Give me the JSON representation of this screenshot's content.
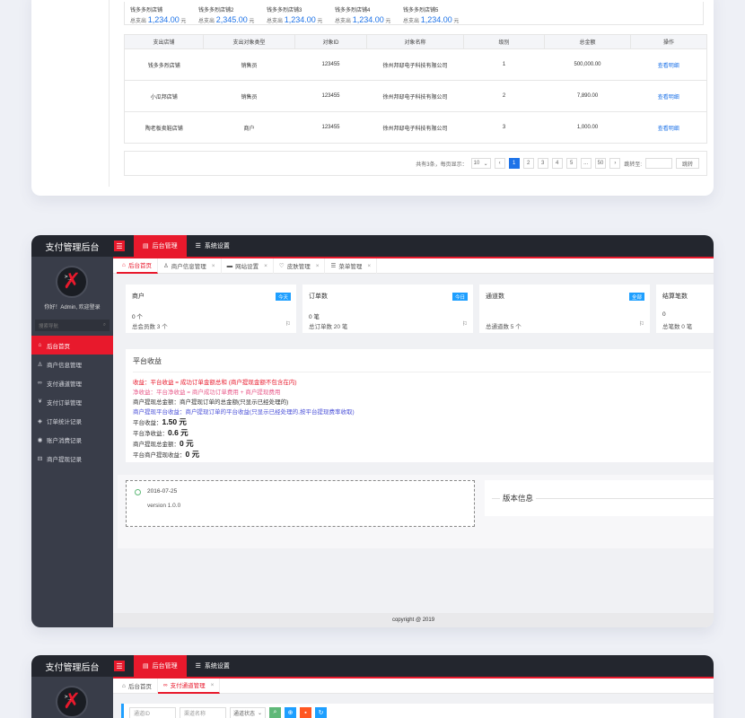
{
  "card1": {
    "stats": [
      {
        "name": "钱多多烈店铺",
        "label": "总支出",
        "amount": "1,234.00",
        "unit": "元"
      },
      {
        "name": "钱多多烈店铺2",
        "label": "总支出",
        "amount": "2,345.00",
        "unit": "元"
      },
      {
        "name": "钱多多烈店铺3",
        "label": "总支出",
        "amount": "1,234.00",
        "unit": "元"
      },
      {
        "name": "钱多多烈店铺4",
        "label": "总支出",
        "amount": "1,234.00",
        "unit": "元"
      },
      {
        "name": "钱多多烈店铺5",
        "label": "总支出",
        "amount": "1,234.00",
        "unit": "元"
      }
    ],
    "table": {
      "headers": [
        "支出店铺",
        "支出对象类型",
        "对象ID",
        "对象名称",
        "级别",
        "总金额",
        "操作"
      ],
      "rows": [
        [
          "钱多多烈店铺",
          "销售员",
          "123455",
          "徐州邦邸电子科技有限公司",
          "1",
          "500,000.00",
          "查看明细"
        ],
        [
          "小瓜邦店铺",
          "销售员",
          "123455",
          "徐州邦邸电子科技有限公司",
          "2",
          "7,890.00",
          "查看明细"
        ],
        [
          "陶老板卖鞋店铺",
          "商户",
          "123455",
          "徐州邦邸电子科技有限公司",
          "3",
          "1,000.00",
          "查看明细"
        ]
      ]
    },
    "pager": {
      "summary": "共有3条，每页显示：",
      "per_page": "10",
      "prev": "‹",
      "pages": [
        "1",
        "2",
        "3",
        "4",
        "5",
        "...",
        "50"
      ],
      "next": "›",
      "jump_label": "跳转至:",
      "go": "跳转"
    }
  },
  "win2": {
    "brand": "支付管理后台",
    "top_nav": [
      {
        "label": "后台管理",
        "icon": "document-icon"
      },
      {
        "label": "系统设置",
        "icon": "list-icon"
      }
    ],
    "welcome": "你好！Admin, 欢迎登录",
    "search_placeholder": "搜索导航",
    "side_menu": [
      {
        "label": "后台首页",
        "icon": "home-icon"
      },
      {
        "label": "商户信息管理",
        "icon": "user-icon"
      },
      {
        "label": "支付通道管理",
        "icon": "link-icon"
      },
      {
        "label": "支付订单管理",
        "icon": "yen-icon"
      },
      {
        "label": "订单统计记录",
        "icon": "shield-check-icon"
      },
      {
        "label": "账户消费记录",
        "icon": "coin-icon"
      },
      {
        "label": "商户提现记录",
        "icon": "withdraw-icon"
      }
    ],
    "tabs": [
      {
        "label": "后台首页",
        "icon": "home-icon"
      },
      {
        "label": "商户信息管理",
        "icon": "user-icon"
      },
      {
        "label": "网站设置",
        "icon": "chat-icon"
      },
      {
        "label": "皮肤管理",
        "icon": "shirt-icon"
      },
      {
        "label": "菜单管理",
        "icon": "list-icon"
      }
    ],
    "cards": [
      {
        "title": "商户",
        "badge": "今天",
        "value": "0 个",
        "sub": "总会员数 3 个"
      },
      {
        "title": "订单数",
        "badge": "今日",
        "value": "0 笔",
        "sub": "总订单数 20 笔"
      },
      {
        "title": "通道数",
        "badge": "全部",
        "value": "",
        "sub": "总通道数 5 个"
      },
      {
        "title": "结算笔数",
        "badge": "",
        "value": "0",
        "sub": "总笔数 0 笔"
      }
    ],
    "income": {
      "title": "平台收益",
      "lines": [
        "收益：平台收益 = 成功订单金额总和 (商户提现金额不包含在内)",
        "净收益：平台净收益 = 商户成功订单费用 + 商户提现费用",
        "商户提现总金额：商户提现订单的总金额(只显示已经处理的)",
        "商户提现平台收益：商户提现订单的平台收益(只显示已经处理的,按平台提现费率收取)"
      ],
      "values": [
        {
          "label": "平台收益：",
          "value": "1.50 元"
        },
        {
          "label": "平台净收益：",
          "value": "0.6 元"
        },
        {
          "label": "商户提现总金额：",
          "value": "0 元"
        },
        {
          "label": "平台商户提现收益：",
          "value": "0 元"
        }
      ]
    },
    "timeline": {
      "date": "2016-07-25",
      "version": "version 1.0.0"
    },
    "version_title": "版本信息",
    "footer": "copyright @ 2019"
  },
  "win3": {
    "brand": "支付管理后台",
    "top_nav": [
      {
        "label": "后台管理",
        "icon": "document-icon"
      },
      {
        "label": "系统设置",
        "icon": "list-icon"
      }
    ],
    "tabs": [
      {
        "label": "后台首页",
        "icon": "home-icon"
      },
      {
        "label": "支付通道管理",
        "icon": "link-icon"
      }
    ],
    "filters": {
      "channel_id": "通道ID",
      "channel_name": "渠道名称",
      "channel_status": "通道状态"
    },
    "colors": {
      "red": "#e8192c",
      "green": "#5fb878",
      "blue": "#1e9fff",
      "orange": "#ff5722"
    }
  }
}
